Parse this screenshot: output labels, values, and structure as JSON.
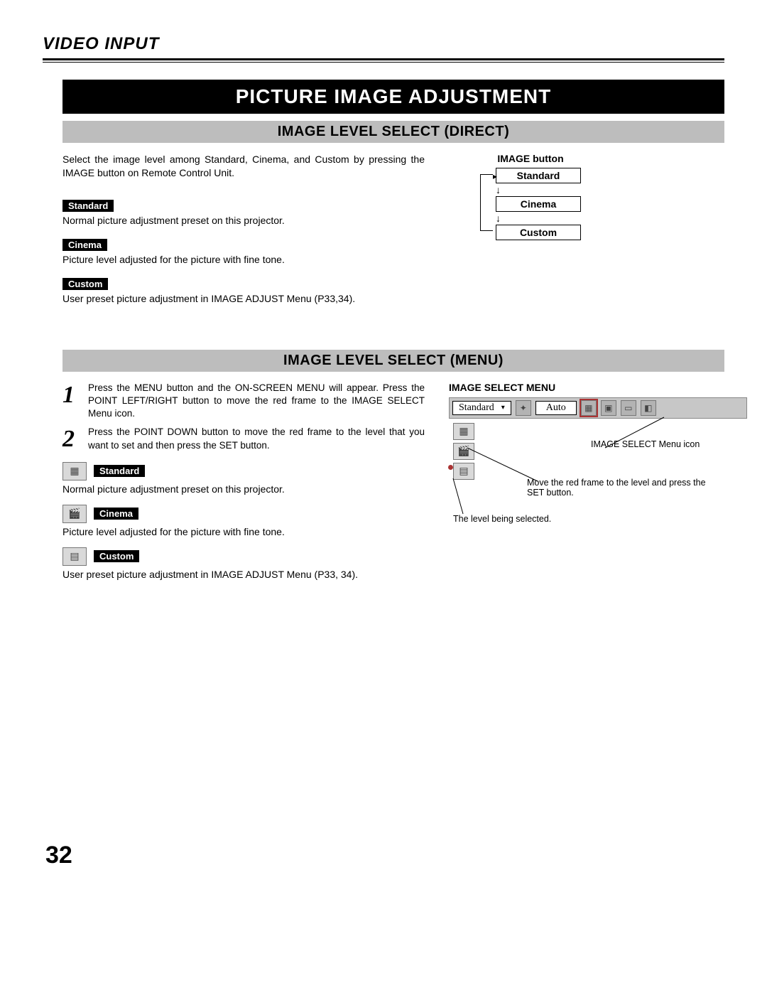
{
  "header": {
    "section_title": "VIDEO INPUT"
  },
  "banner": "PICTURE IMAGE ADJUSTMENT",
  "direct": {
    "subheading": "IMAGE LEVEL SELECT (DIRECT)",
    "intro": "Select the image level among Standard, Cinema, and Custom by pressing the IMAGE button on  Remote Control Unit.",
    "items": [
      {
        "label": "Standard",
        "desc": "Normal picture adjustment preset on this projector."
      },
      {
        "label": "Cinema",
        "desc": "Picture level adjusted for the picture with fine tone."
      },
      {
        "label": "Custom",
        "desc": "User preset picture adjustment in IMAGE ADJUST Menu (P33,34)."
      }
    ],
    "flow": {
      "heading": "IMAGE button",
      "levels": [
        "Standard",
        "Cinema",
        "Custom"
      ]
    }
  },
  "menu": {
    "subheading": "IMAGE LEVEL SELECT (MENU)",
    "steps": [
      {
        "num": "1",
        "text": "Press the MENU button and the ON-SCREEN MENU will appear.  Press the POINT LEFT/RIGHT button to move the red frame to the IMAGE SELECT Menu icon."
      },
      {
        "num": "2",
        "text": "Press the POINT DOWN button to move the red frame to the level that you want to set and then press the SET button."
      }
    ],
    "items": [
      {
        "icon": "standard-mode-icon",
        "glyph": "▦",
        "label": "Standard",
        "desc": "Normal picture adjustment preset on this projector."
      },
      {
        "icon": "cinema-mode-icon",
        "glyph": "🎬",
        "label": "Cinema",
        "desc": "Picture level adjusted for the picture with fine tone."
      },
      {
        "icon": "custom-mode-icon",
        "glyph": "▤",
        "label": "Custom",
        "desc": "User preset picture adjustment in IMAGE ADJUST Menu (P33, 34)."
      }
    ]
  },
  "menushot": {
    "title": "IMAGE SELECT MENU",
    "dropdown_value": "Standard",
    "auto_value": "Auto",
    "callout_menu_icon": "IMAGE SELECT Menu icon",
    "callout_move_frame": "Move the red frame to the level and press the SET button.",
    "callout_selected": "The level being selected."
  },
  "page_number": "32"
}
